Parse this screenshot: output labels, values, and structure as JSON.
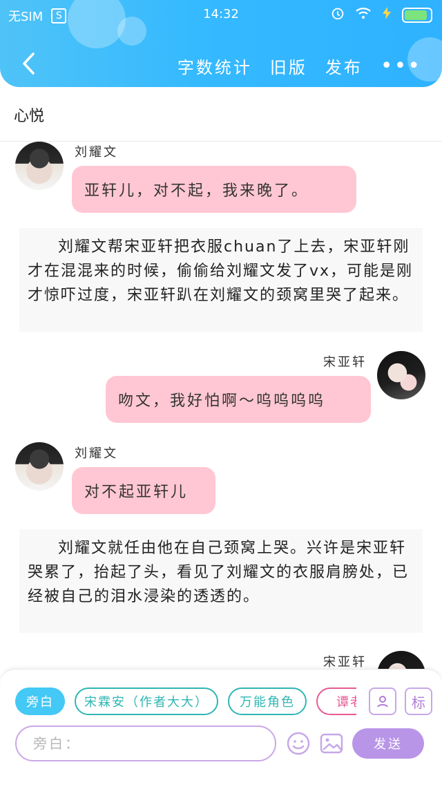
{
  "status_bar": {
    "carrier": "无SIM",
    "sim_icon_label": "S",
    "time": "14:32"
  },
  "header": {
    "actions": [
      "字数统计",
      "旧版",
      "发布"
    ],
    "more": "•••"
  },
  "chat": {
    "title": "心悦",
    "messages": [
      {
        "speaker": "刘耀文",
        "text": "亚轩儿，对不起，我来晚了。"
      },
      {
        "narration": "刘耀文帮宋亚轩把衣服chuan了上去，宋亚轩刚才在混混来的时候，偷偷给刘耀文发了vx，可能是刚才惊吓过度，宋亚轩趴在刘耀文的颈窝里哭了起来。"
      },
      {
        "speaker": "宋亚轩",
        "text": "吻文，我好怕啊～呜呜呜呜"
      },
      {
        "speaker": "刘耀文",
        "text": "对不起亚轩儿"
      },
      {
        "narration": "刘耀文就任由他在自己颈窝上哭。兴许是宋亚轩哭累了，抬起了头，看见了刘耀文的衣服肩膀处，已经被自己的泪水浸染的透透的。"
      },
      {
        "speaker": "宋亚轩"
      }
    ]
  },
  "composer": {
    "roles": [
      "旁白",
      "宋霖安（作者大大）",
      "万能角色",
      "谭老"
    ],
    "tool_label": "标",
    "input_placeholder": "旁白：",
    "send_label": "发送"
  }
}
